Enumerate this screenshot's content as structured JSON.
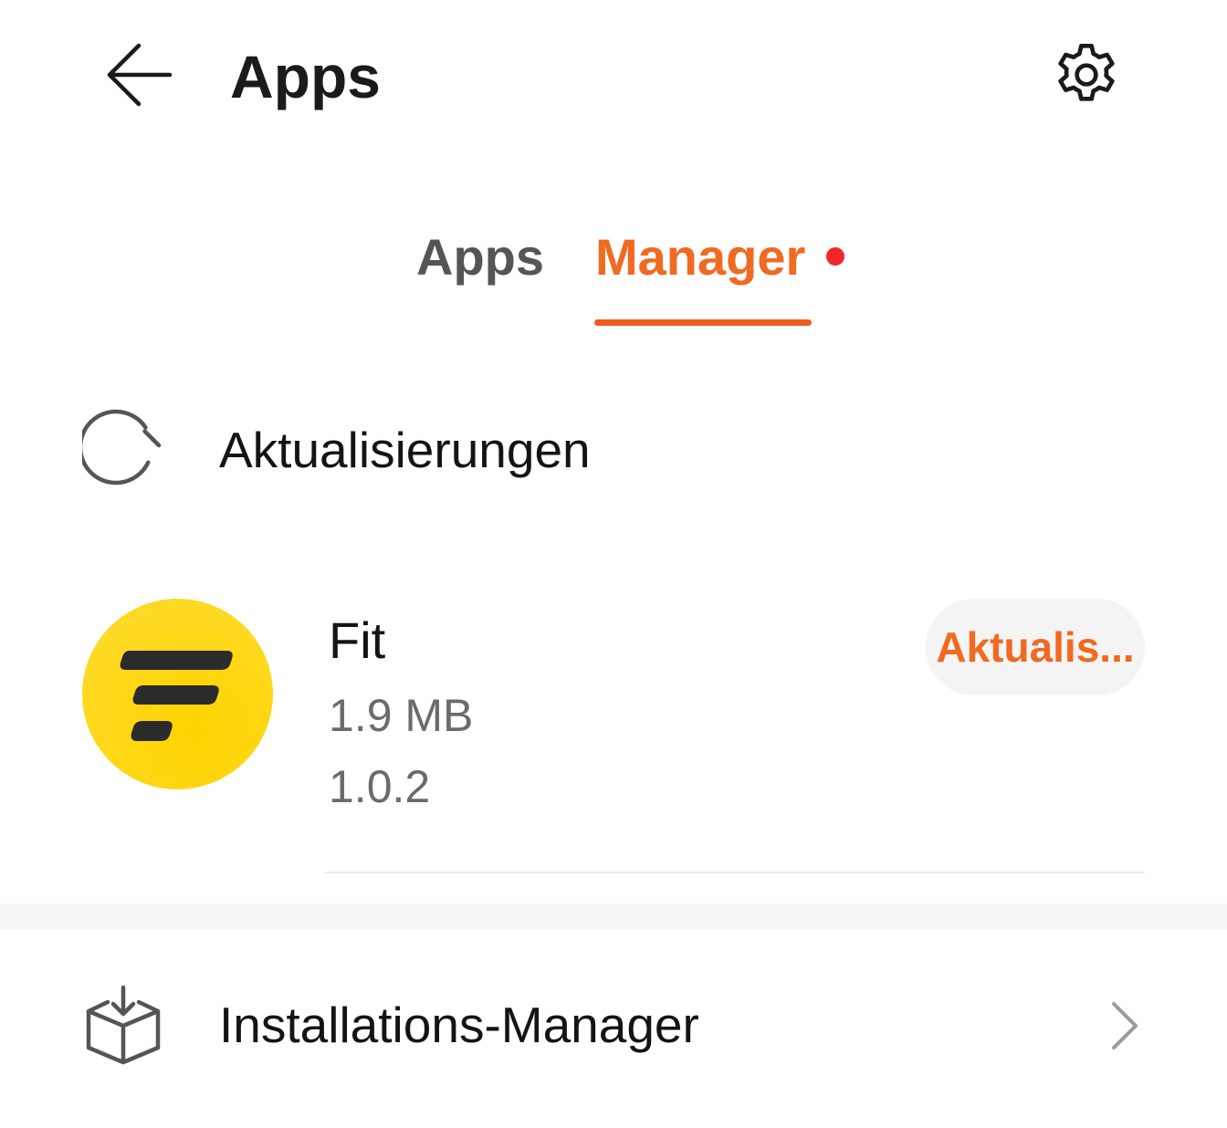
{
  "header": {
    "title": "Apps",
    "back_icon": "arrow-left-icon",
    "settings_icon": "gear-icon"
  },
  "tabs": [
    {
      "label": "Apps",
      "active": false
    },
    {
      "label": "Manager",
      "active": true,
      "has_badge": true
    }
  ],
  "colors": {
    "accent": "#f06a21",
    "badge": "#f4262a",
    "app_icon_bg": "#ffd400"
  },
  "updates": {
    "label": "Aktualisierungen",
    "icon": "refresh-icon"
  },
  "apps": [
    {
      "name": "Fit",
      "size": "1.9 MB",
      "version": "1.0.2",
      "icon": "fit-app-icon",
      "action_label": "Aktualis..."
    }
  ],
  "installs": {
    "label": "Installations-Manager",
    "icon": "box-download-icon",
    "chevron_icon": "chevron-right-icon"
  }
}
